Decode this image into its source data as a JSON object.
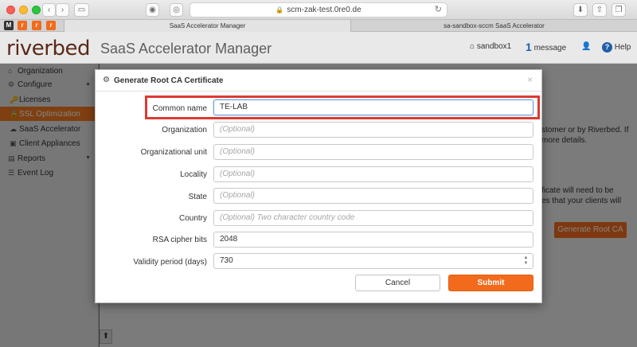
{
  "browser": {
    "url": "scm-zak-test.0re0.de",
    "tabs": [
      {
        "label": "SaaS Accelerator Manager"
      },
      {
        "label": "sa-sandbox-sccm SaaS Accelerator"
      }
    ]
  },
  "header": {
    "brand": "riverbed",
    "app_title": "SaaS Accelerator Manager",
    "user": "sandbox1",
    "message_count": "1",
    "message_label": "message",
    "help_label": "Help"
  },
  "sidebar": {
    "items": [
      {
        "label": "Organization",
        "icon": "home-icon"
      },
      {
        "label": "Configure",
        "icon": "gear-icon"
      },
      {
        "label": "Licenses",
        "icon": "key-icon"
      },
      {
        "label": "SSL Optimization",
        "icon": "lock-icon"
      },
      {
        "label": "SaaS Accelerator",
        "icon": "accelerator-icon"
      },
      {
        "label": "Client Appliances",
        "icon": "appliance-icon"
      },
      {
        "label": "Reports",
        "icon": "reports-icon"
      },
      {
        "label": "Event Log",
        "icon": "list-icon"
      }
    ]
  },
  "background": {
    "text_line1": "stomer or by Riverbed. If",
    "text_line2": "more details.",
    "text_line3": "ficate will need to be",
    "text_line4": "es that your clients will",
    "generate_button": "Generate Root CA"
  },
  "modal": {
    "title": "Generate Root CA Certificate",
    "fields": {
      "common_name": {
        "label": "Common name",
        "value": "TE-LAB"
      },
      "organization": {
        "label": "Organization",
        "placeholder": "(Optional)"
      },
      "org_unit": {
        "label": "Organizational unit",
        "placeholder": "(Optional)"
      },
      "locality": {
        "label": "Locality",
        "placeholder": "(Optional)"
      },
      "state": {
        "label": "State",
        "placeholder": "(Optional)"
      },
      "country": {
        "label": "Country",
        "placeholder": "(Optional) Two character country code"
      },
      "rsa_bits": {
        "label": "RSA cipher bits",
        "value": "2048"
      },
      "validity": {
        "label": "Validity period (days)",
        "value": "730"
      }
    },
    "cancel_label": "Cancel",
    "submit_label": "Submit"
  },
  "colors": {
    "accent": "#f26b1d",
    "highlight": "#dd3a32",
    "brand": "#5a2a18"
  }
}
